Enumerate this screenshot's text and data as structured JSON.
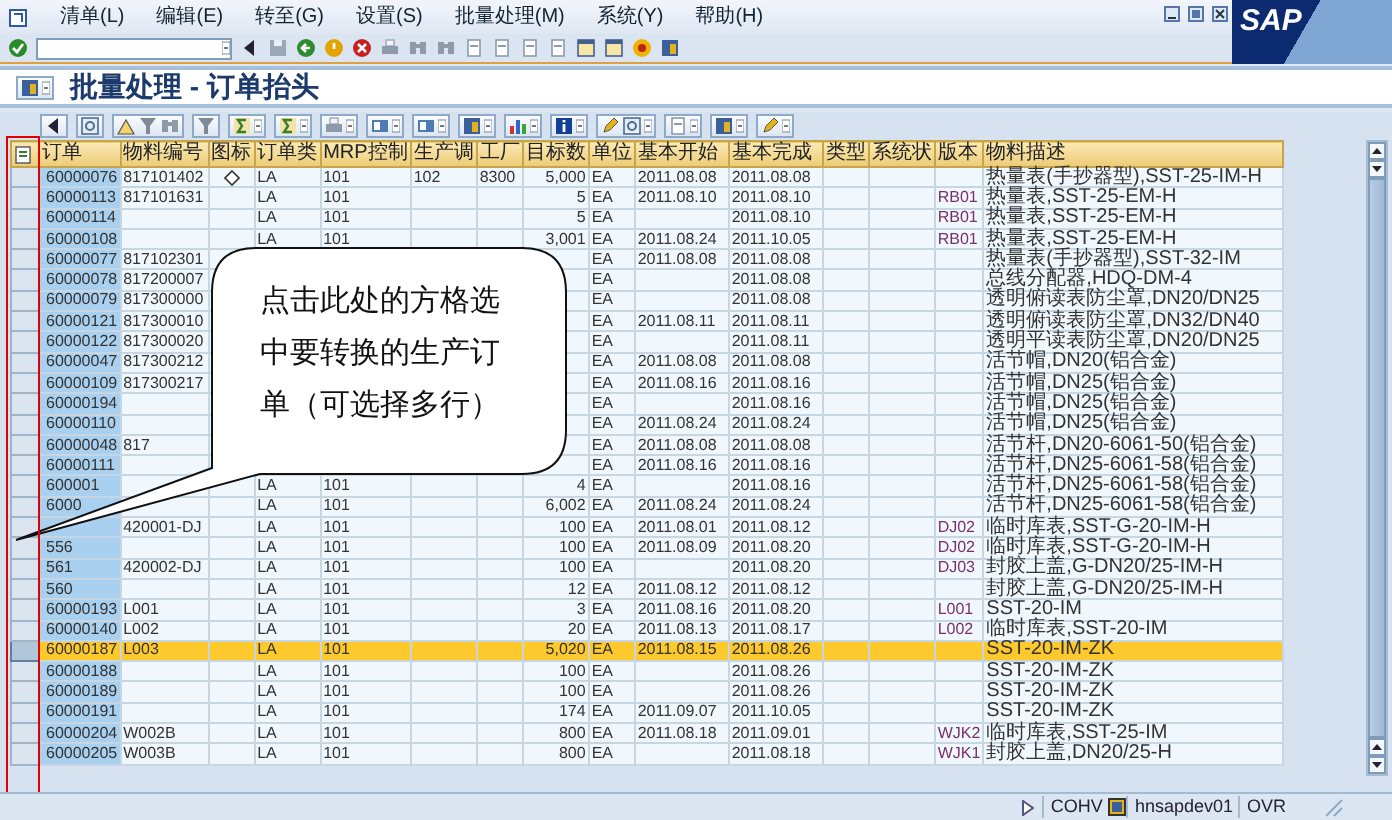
{
  "menu": [
    "清单(L)",
    "编辑(E)",
    "转至(G)",
    "设置(S)",
    "批量处理(M)",
    "系统(Y)",
    "帮助(H)"
  ],
  "logo": "SAP",
  "title": "批量处理 - 订单抬头",
  "table": {
    "columns": [
      "订单",
      "物料编号",
      "图标",
      "订单类",
      "MRP控制",
      "生产调",
      "工厂",
      "目标数",
      "单位",
      "基本开始",
      "基本完成",
      "类型",
      "系统状",
      "版本",
      "物料描述"
    ],
    "rows": [
      {
        "selected": false,
        "order": "60000076",
        "material": "817101402",
        "icon": true,
        "order_type": "LA",
        "mrp_controller": "101",
        "production_scheduler": "102",
        "plant": "8300",
        "target_qty": "5,000",
        "unit": "EA",
        "basic_start": "2011.08.08",
        "basic_finish": "2011.08.08",
        "description": "热量表(手抄器型),SST-25-IM-H"
      },
      {
        "selected": false,
        "order": "60000113",
        "material": "817101631",
        "order_type": "LA",
        "mrp_controller": "101",
        "target_qty": "5",
        "unit": "EA",
        "basic_start": "2011.08.10",
        "basic_finish": "2011.08.10",
        "version": "RB01",
        "description": "热量表,SST-25-EM-H"
      },
      {
        "selected": false,
        "order": "60000114",
        "order_type": "LA",
        "mrp_controller": "101",
        "target_qty": "5",
        "unit": "EA",
        "basic_finish": "2011.08.10",
        "version": "RB01",
        "description": "热量表,SST-25-EM-H"
      },
      {
        "selected": false,
        "order": "60000108",
        "order_type": "LA",
        "mrp_controller": "101",
        "target_qty": "3,001",
        "unit": "EA",
        "basic_start": "2011.08.24",
        "basic_finish": "2011.10.05",
        "version": "RB01",
        "description": "热量表,SST-25-EM-H"
      },
      {
        "selected": false,
        "order": "60000077",
        "material": "817102301",
        "unit": "EA",
        "basic_start": "2011.08.08",
        "basic_finish": "2011.08.08",
        "description": "热量表(手抄器型),SST-32-IM"
      },
      {
        "selected": false,
        "order": "60000078",
        "material": "817200007",
        "unit": "EA",
        "basic_finish": "2011.08.08",
        "description": "总线分配器,HDQ-DM-4"
      },
      {
        "selected": false,
        "order": "60000079",
        "material": "817300000",
        "unit": "EA",
        "basic_finish": "2011.08.08",
        "description": "透明俯读表防尘罩,DN20/DN25"
      },
      {
        "selected": false,
        "order": "60000121",
        "material": "817300010",
        "unit": "EA",
        "basic_start": "2011.08.11",
        "basic_finish": "2011.08.11",
        "description": "透明俯读表防尘罩,DN32/DN40"
      },
      {
        "selected": false,
        "order": "60000122",
        "material": "817300020",
        "unit": "EA",
        "basic_finish": "2011.08.11",
        "description": "透明平读表防尘罩,DN20/DN25"
      },
      {
        "selected": false,
        "order": "60000047",
        "material": "817300212",
        "unit": "EA",
        "basic_start": "2011.08.08",
        "basic_finish": "2011.08.08",
        "description": "活节帽,DN20(铝合金)"
      },
      {
        "selected": false,
        "order": "60000109",
        "material": "817300217",
        "unit": "EA",
        "basic_start": "2011.08.16",
        "basic_finish": "2011.08.16",
        "description": "活节帽,DN25(铝合金)"
      },
      {
        "selected": false,
        "order": "60000194",
        "unit": "EA",
        "basic_finish": "2011.08.16",
        "description": "活节帽,DN25(铝合金)"
      },
      {
        "selected": false,
        "order": "60000110",
        "unit": "EA",
        "basic_start": "2011.08.24",
        "basic_finish": "2011.08.24",
        "description": "活节帽,DN25(铝合金)"
      },
      {
        "selected": false,
        "order": "60000048",
        "material": "817",
        "unit": "EA",
        "basic_start": "2011.08.08",
        "basic_finish": "2011.08.08",
        "description": "活节杆,DN20-6061-50(铝合金)"
      },
      {
        "selected": false,
        "order": "60000111",
        "unit": "EA",
        "basic_start": "2011.08.16",
        "basic_finish": "2011.08.16",
        "description": "活节杆,DN25-6061-58(铝合金)"
      },
      {
        "selected": false,
        "order": "600001",
        "order_type": "LA",
        "mrp_controller": "101",
        "target_qty": "4",
        "unit": "EA",
        "basic_finish": "2011.08.16",
        "description": "活节杆,DN25-6061-58(铝合金)"
      },
      {
        "selected": false,
        "order": "6000",
        "order_type": "LA",
        "mrp_controller": "101",
        "target_qty": "6,002",
        "unit": "EA",
        "basic_start": "2011.08.24",
        "basic_finish": "2011.08.24",
        "description": "活节杆,DN25-6061-58(铝合金)"
      },
      {
        "selected": false,
        "material": "420001-DJ",
        "order_type": "LA",
        "mrp_controller": "101",
        "target_qty": "100",
        "unit": "EA",
        "basic_start": "2011.08.01",
        "basic_finish": "2011.08.12",
        "version": "DJ02",
        "description": "临时库表,SST-G-20-IM-H"
      },
      {
        "selected": false,
        "order": "556",
        "order_type": "LA",
        "mrp_controller": "101",
        "target_qty": "100",
        "unit": "EA",
        "basic_start": "2011.08.09",
        "basic_finish": "2011.08.20",
        "version": "DJ02",
        "description": "临时库表,SST-G-20-IM-H"
      },
      {
        "selected": false,
        "order": "561",
        "material": "420002-DJ",
        "order_type": "LA",
        "mrp_controller": "101",
        "target_qty": "100",
        "unit": "EA",
        "basic_finish": "2011.08.20",
        "version": "DJ03",
        "description": "封胶上盖,G-DN20/25-IM-H"
      },
      {
        "selected": false,
        "order": "560",
        "order_type": "LA",
        "mrp_controller": "101",
        "target_qty": "12",
        "unit": "EA",
        "basic_start": "2011.08.12",
        "basic_finish": "2011.08.12",
        "description": "封胶上盖,G-DN20/25-IM-H"
      },
      {
        "selected": false,
        "order": "60000193",
        "material": "L001",
        "order_type": "LA",
        "mrp_controller": "101",
        "target_qty": "3",
        "unit": "EA",
        "basic_start": "2011.08.16",
        "basic_finish": "2011.08.20",
        "version": "L001",
        "description": "SST-20-IM"
      },
      {
        "selected": false,
        "order": "60000140",
        "material": "L002",
        "order_type": "LA",
        "mrp_controller": "101",
        "target_qty": "20",
        "unit": "EA",
        "basic_start": "2011.08.13",
        "basic_finish": "2011.08.17",
        "version": "L002",
        "description": "临时库表,SST-20-IM"
      },
      {
        "selected": true,
        "order": "60000187",
        "material": "L003",
        "order_type": "LA",
        "mrp_controller": "101",
        "target_qty": "5,020",
        "unit": "EA",
        "basic_start": "2011.08.15",
        "basic_finish": "2011.08.26",
        "description": "SST-20-IM-ZK"
      },
      {
        "selected": false,
        "order": "60000188",
        "order_type": "LA",
        "mrp_controller": "101",
        "target_qty": "100",
        "unit": "EA",
        "basic_finish": "2011.08.26",
        "description": "SST-20-IM-ZK"
      },
      {
        "selected": false,
        "order": "60000189",
        "order_type": "LA",
        "mrp_controller": "101",
        "target_qty": "100",
        "unit": "EA",
        "basic_finish": "2011.08.26",
        "description": "SST-20-IM-ZK"
      },
      {
        "selected": false,
        "order": "60000191",
        "order_type": "LA",
        "mrp_controller": "101",
        "target_qty": "174",
        "unit": "EA",
        "basic_start": "2011.09.07",
        "basic_finish": "2011.10.05",
        "description": "SST-20-IM-ZK"
      },
      {
        "selected": false,
        "order": "60000204",
        "material": "W002B",
        "order_type": "LA",
        "mrp_controller": "101",
        "target_qty": "800",
        "unit": "EA",
        "basic_start": "2011.08.18",
        "basic_finish": "2011.09.01",
        "version": "WJK2",
        "description": "临时库表,SST-25-IM"
      },
      {
        "selected": false,
        "order": "60000205",
        "material": "W003B",
        "order_type": "LA",
        "mrp_controller": "101",
        "target_qty": "800",
        "unit": "EA",
        "basic_finish": "2011.08.18",
        "version": "WJK1",
        "description": "封胶上盖,DN20/25-H"
      }
    ]
  },
  "callout": "点击此处的方格选中要转换的生产订单（可选择多行）",
  "status_bar": {
    "transaction": "COHV",
    "server": "hnsapdev01",
    "mode": "OVR"
  }
}
